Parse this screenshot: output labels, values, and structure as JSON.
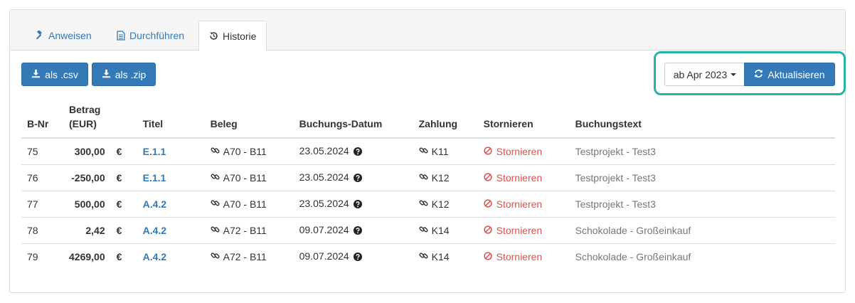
{
  "tabs": [
    {
      "label": "Anweisen",
      "icon": "gavel-icon"
    },
    {
      "label": "Durchführen",
      "icon": "document-icon"
    },
    {
      "label": "Historie",
      "icon": "history-icon"
    }
  ],
  "active_tab": "Historie",
  "toolbar": {
    "csv_label": "als .csv",
    "zip_label": "als .zip",
    "period_label": "ab Apr 2023",
    "refresh_label": "Aktualisieren"
  },
  "table": {
    "headers": {
      "bnr": "B-Nr",
      "betrag_line1": "Betrag",
      "betrag_line2": "(EUR)",
      "titel": "Titel",
      "beleg": "Beleg",
      "datum": "Buchungs-Datum",
      "zahlung": "Zahlung",
      "stornieren": "Stornieren",
      "buchungstext": "Buchungstext"
    },
    "rows": [
      {
        "bnr": "75",
        "betrag": "300,00",
        "currency": "€",
        "titel": "E.1.1",
        "beleg": "A70 - B11",
        "datum": "23.05.2024",
        "zahlung": "K11",
        "storno": "Stornieren",
        "text": "Testprojekt - Test3"
      },
      {
        "bnr": "76",
        "betrag": "-250,00",
        "currency": "€",
        "titel": "E.1.1",
        "beleg": "A70 - B11",
        "datum": "23.05.2024",
        "zahlung": "K12",
        "storno": "Stornieren",
        "text": "Testprojekt - Test3"
      },
      {
        "bnr": "77",
        "betrag": "500,00",
        "currency": "€",
        "titel": "A.4.2",
        "beleg": "A70 - B11",
        "datum": "23.05.2024",
        "zahlung": "K12",
        "storno": "Stornieren",
        "text": "Testprojekt - Test3"
      },
      {
        "bnr": "78",
        "betrag": "2,42",
        "currency": "€",
        "titel": "A.4.2",
        "beleg": "A72 - B11",
        "datum": "09.07.2024",
        "zahlung": "K14",
        "storno": "Stornieren",
        "text": "Schokolade - Großeinkauf"
      },
      {
        "bnr": "79",
        "betrag": "4269,00",
        "currency": "€",
        "titel": "A.4.2",
        "beleg": "A72 - B11",
        "datum": "09.07.2024",
        "zahlung": "K14",
        "storno": "Stornieren",
        "text": "Schokolade - Großeinkauf"
      }
    ]
  },
  "colors": {
    "primary": "#337ab7",
    "danger": "#d9534f",
    "muted": "#777777",
    "highlight": "#26b3a3"
  }
}
